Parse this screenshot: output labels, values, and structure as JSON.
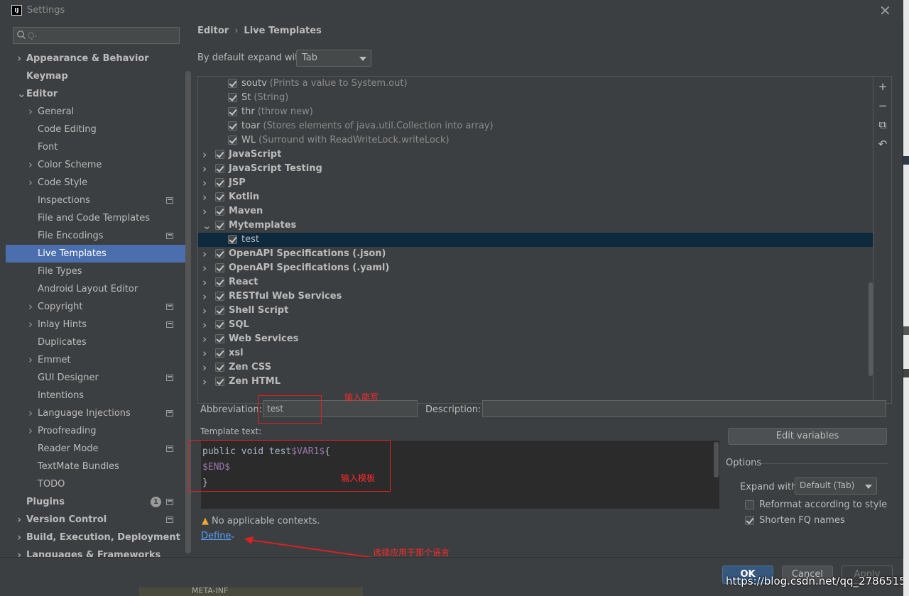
{
  "window": {
    "title": "Settings",
    "app_icon_text": "IJ"
  },
  "search": {
    "placeholder": "Q-"
  },
  "sidebar": {
    "items": [
      {
        "label": "Appearance & Behavior",
        "bold": true,
        "chevron": "right",
        "indent": 0
      },
      {
        "label": "Keymap",
        "bold": true,
        "chevron": "",
        "indent": 0
      },
      {
        "label": "Editor",
        "bold": true,
        "chevron": "down",
        "indent": 0
      },
      {
        "label": "General",
        "chevron": "right",
        "indent": 1
      },
      {
        "label": "Code Editing",
        "chevron": "",
        "indent": 1
      },
      {
        "label": "Font",
        "chevron": "",
        "indent": 1
      },
      {
        "label": "Color Scheme",
        "chevron": "right",
        "indent": 1
      },
      {
        "label": "Code Style",
        "chevron": "right",
        "indent": 1
      },
      {
        "label": "Inspections",
        "chevron": "",
        "indent": 1,
        "project": true
      },
      {
        "label": "File and Code Templates",
        "chevron": "",
        "indent": 1
      },
      {
        "label": "File Encodings",
        "chevron": "",
        "indent": 1,
        "project": true
      },
      {
        "label": "Live Templates",
        "chevron": "",
        "indent": 1,
        "selected": true
      },
      {
        "label": "File Types",
        "chevron": "",
        "indent": 1
      },
      {
        "label": "Android Layout Editor",
        "chevron": "",
        "indent": 1
      },
      {
        "label": "Copyright",
        "chevron": "right",
        "indent": 1,
        "project": true
      },
      {
        "label": "Inlay Hints",
        "chevron": "right",
        "indent": 1,
        "project": true
      },
      {
        "label": "Duplicates",
        "chevron": "",
        "indent": 1
      },
      {
        "label": "Emmet",
        "chevron": "right",
        "indent": 1
      },
      {
        "label": "GUI Designer",
        "chevron": "",
        "indent": 1,
        "project": true
      },
      {
        "label": "Intentions",
        "chevron": "",
        "indent": 1
      },
      {
        "label": "Language Injections",
        "chevron": "right",
        "indent": 1,
        "project": true
      },
      {
        "label": "Proofreading",
        "chevron": "right",
        "indent": 1
      },
      {
        "label": "Reader Mode",
        "chevron": "",
        "indent": 1,
        "project": true
      },
      {
        "label": "TextMate Bundles",
        "chevron": "",
        "indent": 1
      },
      {
        "label": "TODO",
        "chevron": "",
        "indent": 1
      },
      {
        "label": "Plugins",
        "bold": true,
        "chevron": "",
        "indent": 0,
        "badge": "1",
        "project": true
      },
      {
        "label": "Version Control",
        "bold": true,
        "chevron": "right",
        "indent": 0,
        "project": true
      },
      {
        "label": "Build, Execution, Deployment",
        "bold": true,
        "chevron": "right",
        "indent": 0
      },
      {
        "label": "Languages & Frameworks",
        "bold": true,
        "chevron": "right",
        "indent": 0
      }
    ]
  },
  "breadcrumb": {
    "parent": "Editor",
    "separator": "›",
    "current": "Live Templates"
  },
  "expand_default": {
    "label": "By default expand with",
    "value": "Tab"
  },
  "templates": {
    "rows": [
      {
        "name": "soutv",
        "desc": "(Prints a value to System.out)",
        "group": false,
        "checked": true
      },
      {
        "name": "St",
        "desc": "(String)",
        "group": false,
        "checked": true
      },
      {
        "name": "thr",
        "desc": "(throw new)",
        "group": false,
        "checked": true
      },
      {
        "name": "toar",
        "desc": "(Stores elements of java.util.Collection into array)",
        "group": false,
        "checked": true
      },
      {
        "name": "WL",
        "desc": "(Surround with ReadWriteLock.writeLock)",
        "group": false,
        "checked": true
      },
      {
        "name": "JavaScript",
        "desc": "",
        "group": true,
        "chevron": "right",
        "checked": true
      },
      {
        "name": "JavaScript Testing",
        "desc": "",
        "group": true,
        "chevron": "right",
        "checked": true
      },
      {
        "name": "JSP",
        "desc": "",
        "group": true,
        "chevron": "right",
        "checked": true
      },
      {
        "name": "Kotlin",
        "desc": "",
        "group": true,
        "chevron": "right",
        "checked": true
      },
      {
        "name": "Maven",
        "desc": "",
        "group": true,
        "chevron": "right",
        "checked": true
      },
      {
        "name": "Mytemplates",
        "desc": "",
        "group": true,
        "chevron": "down",
        "checked": true
      },
      {
        "name": "test",
        "desc": "",
        "group": false,
        "checked": true,
        "selected": true
      },
      {
        "name": "OpenAPI Specifications (.json)",
        "desc": "",
        "group": true,
        "chevron": "right",
        "checked": true
      },
      {
        "name": "OpenAPI Specifications (.yaml)",
        "desc": "",
        "group": true,
        "chevron": "right",
        "checked": true
      },
      {
        "name": "React",
        "desc": "",
        "group": true,
        "chevron": "right",
        "checked": true
      },
      {
        "name": "RESTful Web Services",
        "desc": "",
        "group": true,
        "chevron": "right",
        "checked": true
      },
      {
        "name": "Shell Script",
        "desc": "",
        "group": true,
        "chevron": "right",
        "checked": true
      },
      {
        "name": "SQL",
        "desc": "",
        "group": true,
        "chevron": "right",
        "checked": true
      },
      {
        "name": "Web Services",
        "desc": "",
        "group": true,
        "chevron": "right",
        "checked": true
      },
      {
        "name": "xsl",
        "desc": "",
        "group": true,
        "chevron": "right",
        "checked": true
      },
      {
        "name": "Zen CSS",
        "desc": "",
        "group": true,
        "chevron": "right",
        "checked": true
      },
      {
        "name": "Zen HTML",
        "desc": "",
        "group": true,
        "chevron": "right",
        "checked": true
      }
    ],
    "tools": [
      "+",
      "−",
      "⧉",
      "↶"
    ]
  },
  "form": {
    "abbreviation_label": "Abbreviation:",
    "abbreviation_value": "test",
    "description_label": "Description:",
    "description_value": "",
    "template_text_label": "Template text:",
    "code_lines": [
      [
        {
          "t": "public void test",
          "c": "plain"
        },
        {
          "t": "$VAR1$",
          "c": "var"
        },
        {
          "t": "{",
          "c": "plain"
        }
      ],
      [
        {
          "t": "$END$",
          "c": "var"
        }
      ],
      [
        {
          "t": "}",
          "c": "plain"
        }
      ]
    ],
    "no_context_text": "No applicable contexts.",
    "define_label": "Define",
    "edit_variables_label": "Edit variables",
    "options_title": "Options",
    "expand_with_label": "Expand with",
    "expand_with_value": "Default (Tab)",
    "reformat_label": "Reformat according to style",
    "reformat_checked": false,
    "shorten_label": "Shorten FQ names",
    "shorten_checked": true
  },
  "annotations": {
    "abbr_note": "输入简写",
    "template_note": "输入模板",
    "define_note": "选择应用于那个语言"
  },
  "buttons": {
    "ok": "OK",
    "cancel": "Cancel",
    "apply": "Apply",
    "help": "?"
  },
  "background": {
    "behind_text": "META-INF",
    "watermark": "https://blog.csdn.net/qq_27865153"
  },
  "colors": {
    "selection": "#4b6eaf",
    "tree_selection": "#0d293e",
    "link": "#589df6",
    "annotation": "#e02020",
    "template_var": "#9876aa",
    "ok_button": "#365880"
  }
}
